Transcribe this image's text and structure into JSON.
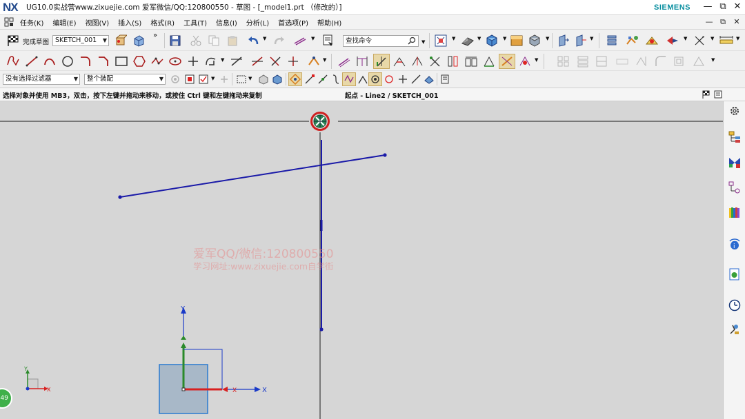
{
  "window": {
    "logo": "NX",
    "title": "UG10.0实战营www.zixuejie.com 爱军微信/QQ:120800550 - 草图 - [_model1.prt （修改的）]",
    "brand": "SIEMENS",
    "controls": {
      "minimize": "—",
      "restore": "⧉",
      "close": "✕"
    },
    "menu_controls": {
      "minimize": "—",
      "restore": "⧉",
      "close": "✕"
    }
  },
  "menubar": {
    "items": [
      "任务(K)",
      "编辑(E)",
      "视图(V)",
      "插入(S)",
      "格式(R)",
      "工具(T)",
      "信息(I)",
      "分析(L)",
      "首选项(P)",
      "帮助(H)"
    ]
  },
  "toolbar1": {
    "finish_sketch_label": "完成草图",
    "sketch_name": "SKETCH_001",
    "search_placeholder": "查找命令"
  },
  "toolbar3": {
    "filter_select": "没有选择过滤器",
    "scope_select": "整个装配"
  },
  "status": {
    "prompt": "选择对象并使用 MB3，双击，按下左键并拖动来移动，或按住 Ctrl 键和左键拖动来复制",
    "selection_info": "起点 - Line2 / SKETCH_001"
  },
  "canvas": {
    "watermark_line1": "爱军QQ/微信:120800550",
    "watermark_line2": "学习网址:www.zixuejie.com自学街",
    "axis_labels": {
      "x": "X",
      "y": "Y"
    },
    "badge_text": "49"
  },
  "colors": {
    "sketch_line": "#1a1aa8",
    "axis_red": "#d03030",
    "axis_green": "#2a8a2a",
    "axis_blue": "#1a3ac8",
    "brand": "#0a8fa0",
    "background": "#d6d6d6"
  }
}
